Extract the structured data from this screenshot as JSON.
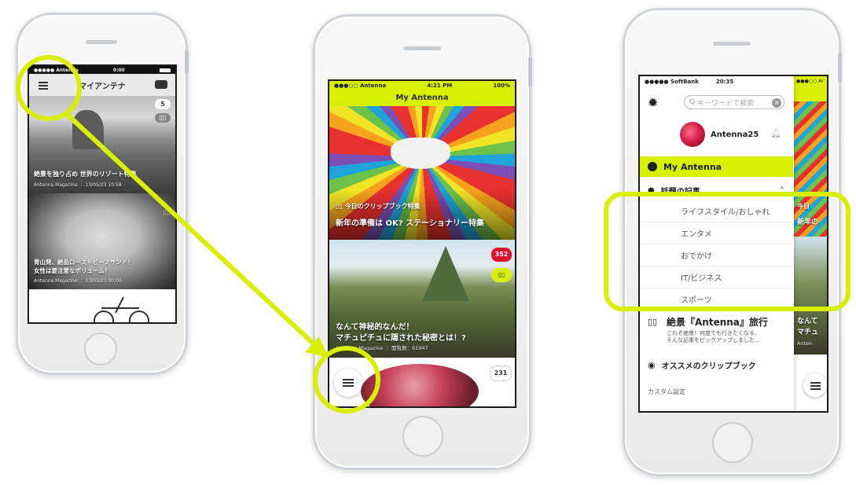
{
  "phone1": {
    "status_carrier": "●●●●● Antenna",
    "status_time": "0:00",
    "title": "マイアンテナ",
    "card1_badge": "5",
    "card1_caption": "絶景を独り占め 世界のリゾート特集",
    "card1_meta": "Antenna Magazine ｜ 13/05/23 10:58",
    "card2_caption_line1": "青山発、絶品ローストビーフサンド！",
    "card2_caption_line2": "女性は要注意なボリューム！",
    "card2_meta": "Antenna Magazine ｜ 13/05/23 00:00"
  },
  "phone2": {
    "status_carrier": "●●●○○ Antenna",
    "status_time": "4:21 PM",
    "status_battery": "100%",
    "title": "My Antenna",
    "card1_kicker": "今日のクリップブック特集",
    "card1_caption": "新年の準備は OK? ステーショナリー特集",
    "card2_badge": "352",
    "card2_caption_line1": "なんて神秘的なんだ！",
    "card2_caption_line2": "マチュピチュに隠された秘密とは！?",
    "card2_meta": "Antenna Magazine ｜ 閲覧数：61947",
    "card3_badge": "231"
  },
  "phone3": {
    "status_carrier": "●●●●● SoftBank",
    "status_time": "20:35",
    "search_placeholder": "キーワードで検索",
    "user_name": "Antenna25",
    "menu_my_antenna": "My Antenna",
    "menu_topics": "話題の記事",
    "sub_items": [
      "ライフスタイル/おしゃれ",
      "エンタメ",
      "おでかけ",
      "IT/ビジネス",
      "スポーツ"
    ],
    "feature_title": "絶景『Antenna』旅行",
    "feature_desc_line1": "これぞ絶景！何度でも行きたくなる、",
    "feature_desc_line2": "そんな記事をピックアップしました…",
    "menu_recommended": "オススメのクリップブック",
    "menu_custom": "カスタム設定",
    "peek_carrier": "●●●○○ Ar",
    "peek_kicker": "今日",
    "peek_caption": "新年の",
    "peek_caption2_line1": "なんて",
    "peek_caption2_line2": "マチュ",
    "peek_meta": "Anten"
  },
  "colors": {
    "accent": "#d7f000",
    "badge_red": "#e0122a"
  }
}
